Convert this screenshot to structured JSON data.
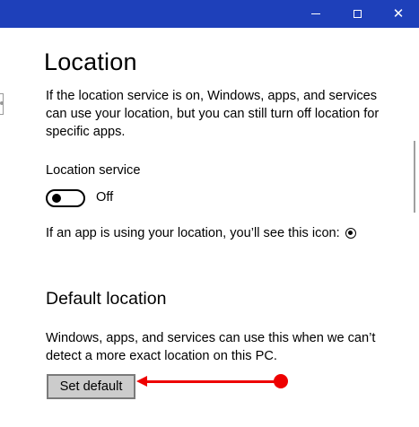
{
  "window": {
    "minimize_icon": "minimize-icon",
    "maximize_icon": "maximize-icon",
    "close_icon": "close-icon",
    "close_glyph": "✕",
    "titlebar_color": "#1e40ba"
  },
  "page": {
    "title": "Location",
    "intro": "If the location service is on, Windows, apps, and services can use your location, but you can still turn off location for specific apps."
  },
  "location_service": {
    "label": "Location service",
    "toggle_state": "Off",
    "toggle_on": false
  },
  "icon_notice": {
    "text": "If an app is using your location, you’ll see this icon:",
    "icon": "location-in-use-icon"
  },
  "default_location": {
    "heading": "Default location",
    "description": "Windows, apps, and services can use this when we can’t detect a more exact location on this PC.",
    "button_label": "Set default"
  },
  "annotation": {
    "color": "#ee0000",
    "points_to": "set-default-button"
  }
}
